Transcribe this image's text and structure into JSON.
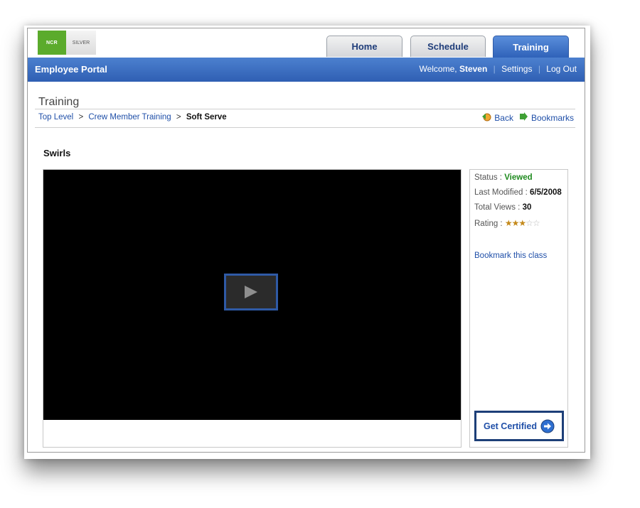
{
  "logo": {
    "left_text": "NCR",
    "right_text": "SILVER"
  },
  "tabs": [
    {
      "label": "Home",
      "active": false
    },
    {
      "label": "Schedule",
      "active": false
    },
    {
      "label": "Training",
      "active": true
    }
  ],
  "header": {
    "portal_title": "Employee Portal",
    "welcome_prefix": "Welcome,",
    "user_name": "Steven",
    "settings_label": "Settings",
    "logout_label": "Log Out",
    "separator": "|"
  },
  "page": {
    "title": "Training"
  },
  "breadcrumb": {
    "items": [
      "Top Level",
      "Crew Member Training"
    ],
    "current": "Soft Serve",
    "separator": ">"
  },
  "nav": {
    "back_label": "Back",
    "bookmarks_label": "Bookmarks"
  },
  "lesson": {
    "title": "Swirls"
  },
  "info": {
    "status_label": "Status :",
    "status_value": "Viewed",
    "modified_label": "Last Modified :",
    "modified_value": "6/5/2008",
    "views_label": "Total Views :",
    "views_value": "30",
    "rating_label": "Rating :",
    "rating_value": 3,
    "rating_max": 5,
    "bookmark_label": "Bookmark this class"
  },
  "actions": {
    "certify_label": "Get Certified"
  },
  "colors": {
    "brand_blue": "#2f5fb3",
    "status_green": "#1e8a1e",
    "link_blue": "#1f4fa8",
    "star_gold": "#c48a1c"
  },
  "icons": [
    "back-icon",
    "bookmarks-icon",
    "play-icon",
    "arrow-right-circle-icon"
  ]
}
